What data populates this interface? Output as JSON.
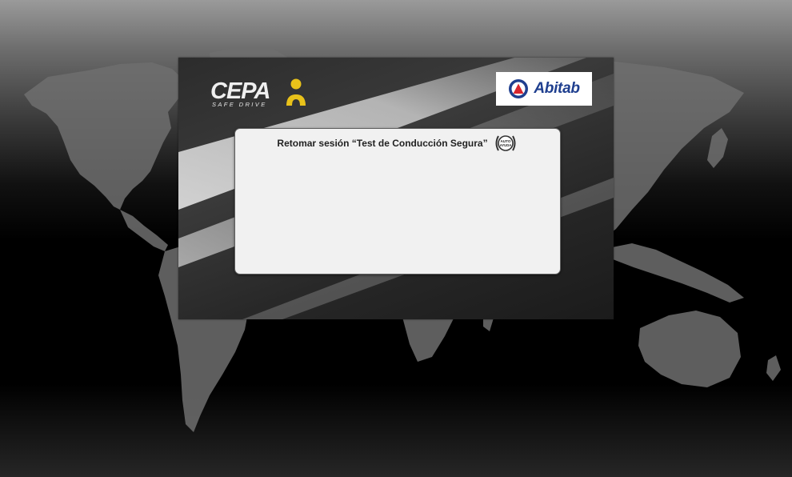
{
  "brand": {
    "cepa_name": "CEPA",
    "cepa_tagline": "SAFE DRIVE",
    "partner_name": "Abitab",
    "partner_icon": "abitab-emblem",
    "colors": {
      "cepa_yellow": "#e9c21a",
      "abitab_blue": "#1f3f8f",
      "abitab_red": "#d7262e",
      "dialog_background": "#f1f1f1"
    }
  },
  "dialog": {
    "title": "Retomar sesión “Test de Conducción Segura”",
    "badge_line1": "AUTO",
    "badge_line2": "AYUDA",
    "badge_icon": "autoayuda-badge"
  }
}
